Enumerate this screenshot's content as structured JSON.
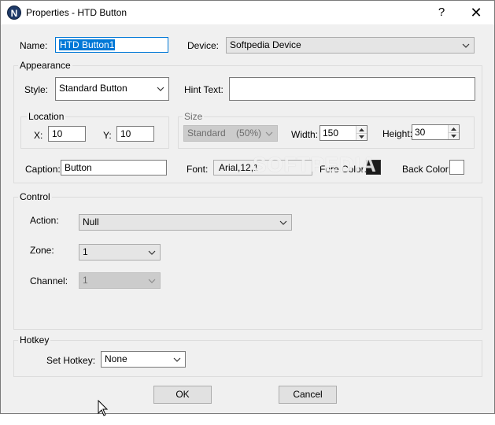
{
  "window": {
    "title": "Properties - HTD Button",
    "app_icon_letter": "N",
    "help_glyph": "?",
    "close_glyph": "✕"
  },
  "form": {
    "name_label": "Name:",
    "name_value": "HTD Button1",
    "device_label": "Device:",
    "device_value": "Softpedia Device"
  },
  "appearance": {
    "group_label": "Appearance",
    "style_label": "Style:",
    "style_value": "Standard Button",
    "hint_label": "Hint Text:",
    "hint_value": "",
    "location": {
      "group_label": "Location",
      "x_label": "X:",
      "x_value": "10",
      "y_label": "Y:",
      "y_value": "10"
    },
    "size": {
      "group_label": "Size",
      "preset_value": "Standard    (50%)",
      "width_label": "Width:",
      "width_value": "150",
      "height_label": "Height:",
      "height_value": "30"
    },
    "caption_label": "Caption:",
    "caption_value": "Button",
    "font_label": "Font:",
    "font_value": "Arial,12,1",
    "fore_color_label": "Fore Color:",
    "fore_color": "#1a1a1a",
    "back_color_label": "Back Color:",
    "back_color": "#ffffff"
  },
  "control": {
    "group_label": "Control",
    "action_label": "Action:",
    "action_value": "Null",
    "zone_label": "Zone:",
    "zone_value": "1",
    "channel_label": "Channel:",
    "channel_value": "1"
  },
  "hotkey": {
    "group_label": "Hotkey",
    "set_label": "Set Hotkey:",
    "set_value": "None"
  },
  "buttons": {
    "ok_label": "OK",
    "cancel_label": "Cancel"
  },
  "watermark": "SOFTPEDIA"
}
